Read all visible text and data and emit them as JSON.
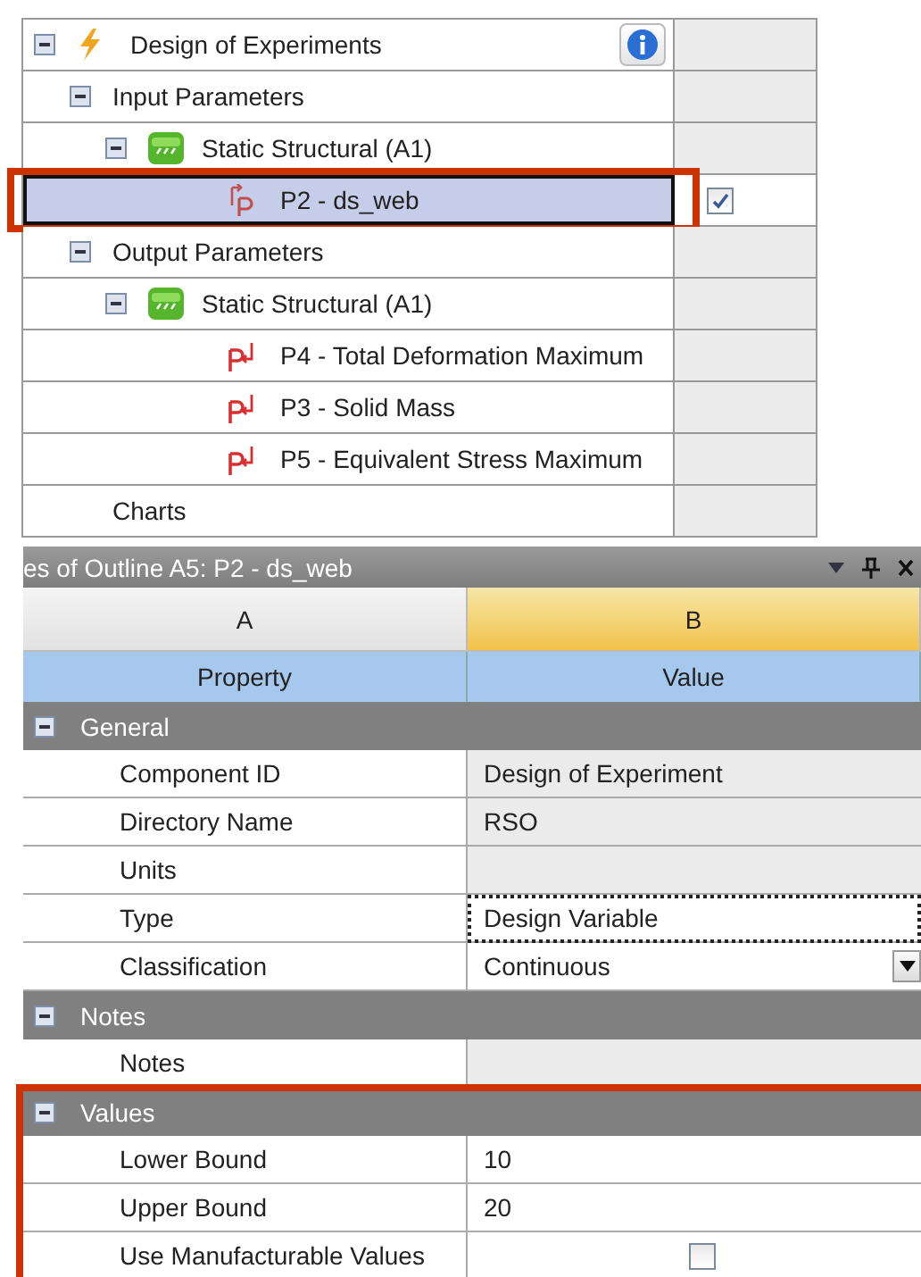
{
  "outline": {
    "rows": [
      {
        "label": "Design of Experiments",
        "kind": "doe",
        "expanded": true,
        "selected": false,
        "highlighted": false,
        "info_button": true,
        "children": [
          {
            "label": "Input Parameters",
            "expanded": true,
            "selected": false,
            "highlighted": false,
            "children": [
              {
                "label": "Static Structural (A1)",
                "kind": "system",
                "expanded": true,
                "selected": false,
                "highlighted": false,
                "children": [
                  {
                    "label": "P2 - ds_web",
                    "kind": "input_parameter",
                    "selected": true,
                    "highlighted": true,
                    "checked": true
                  }
                ]
              }
            ]
          },
          {
            "label": "Output Parameters",
            "expanded": true,
            "selected": false,
            "highlighted": false,
            "children": [
              {
                "label": "Static Structural (A1)",
                "kind": "system",
                "expanded": true,
                "selected": false,
                "highlighted": false,
                "children": [
                  {
                    "label": "P4 - Total Deformation Maximum",
                    "kind": "output_parameter",
                    "selected": false,
                    "highlighted": false
                  },
                  {
                    "label": "P3 - Solid Mass",
                    "kind": "output_parameter",
                    "selected": false,
                    "highlighted": false
                  },
                  {
                    "label": "P5 - Equivalent Stress Maximum",
                    "kind": "output_parameter",
                    "selected": false,
                    "highlighted": false
                  }
                ]
              }
            ]
          },
          {
            "label": "Charts",
            "selected": false,
            "highlighted": false
          }
        ]
      }
    ]
  },
  "properties": {
    "title": "es of Outline A5: P2 - ds_web",
    "column_letters": [
      {
        "label": "A",
        "selected": false
      },
      {
        "label": "B",
        "selected": true
      }
    ],
    "column_headers": [
      "Property",
      "Value"
    ],
    "groups": [
      {
        "title": "General",
        "expanded": true,
        "highlighted": false,
        "rows": [
          {
            "property": "Component ID",
            "value": "Design of Experiment",
            "kind": "text",
            "editable": false
          },
          {
            "property": "Directory Name",
            "value": "RSO",
            "kind": "text",
            "editable": false
          },
          {
            "property": "Units",
            "kind": "text",
            "editable": false
          },
          {
            "property": "Type",
            "value": "Design Variable",
            "kind": "text",
            "editable": true,
            "focused": true
          },
          {
            "property": "Classification",
            "value": "Continuous",
            "kind": "dropdown",
            "editable": true
          }
        ]
      },
      {
        "title": "Notes",
        "expanded": true,
        "highlighted": false,
        "rows": [
          {
            "property": "Notes",
            "kind": "text",
            "editable": false
          }
        ]
      },
      {
        "title": "Values",
        "expanded": true,
        "highlighted": true,
        "rows": [
          {
            "property": "Lower Bound",
            "value": "10",
            "kind": "text",
            "editable": true
          },
          {
            "property": "Upper Bound",
            "value": "20",
            "kind": "text",
            "editable": true
          },
          {
            "property": "Use Manufacturable Values",
            "kind": "checkbox",
            "checked": false,
            "editable": true
          }
        ]
      }
    ]
  }
}
